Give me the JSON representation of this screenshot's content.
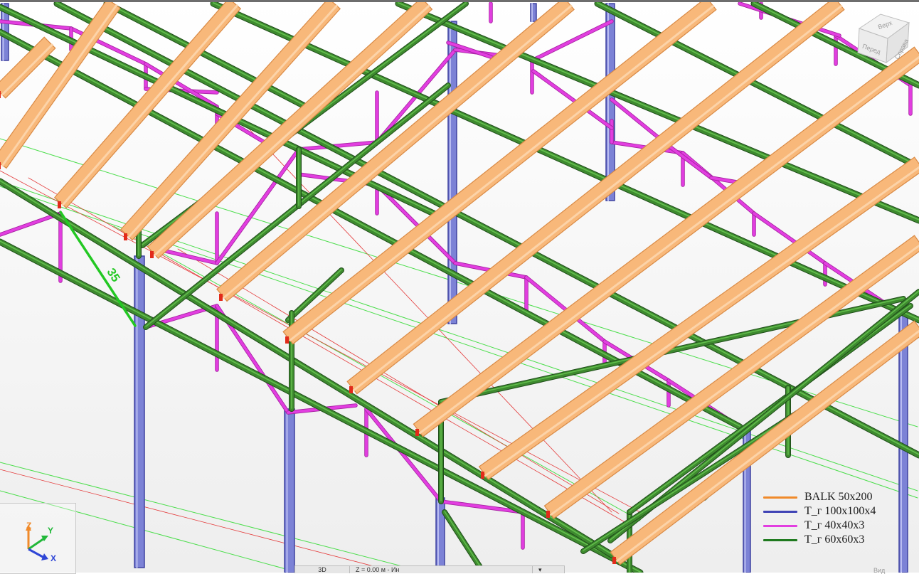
{
  "viewport": {
    "background_top": "#ffffff",
    "background_bottom": "#eeeeee"
  },
  "members": {
    "truss_color": "#3e8a2f",
    "truss_highlight": "#63bf4d",
    "brace_color": "#e23ee0",
    "purlin_color": "#f8b87a",
    "purlin_edge": "#d98a45",
    "column_color": "#7c82d6",
    "column_edge": "#3f43a0",
    "guide_green": "#4cde4c",
    "guide_red": "#e43a3a",
    "node_marker": "#e22a1a"
  },
  "dimension": {
    "value": "35"
  },
  "legend": {
    "items": [
      {
        "label": "BALK 50x200",
        "color": "#f08a2a"
      },
      {
        "label": "T_г 100x100x4",
        "color": "#3f43b5"
      },
      {
        "label": "T_г 40x40x3",
        "color": "#e23ee0"
      },
      {
        "label": "T_г 60x60x3",
        "color": "#1f7a1f"
      }
    ]
  },
  "view_cube": {
    "top_label": "Верх",
    "front_label": "Перед",
    "right_label": "Справа"
  },
  "axis_triad": {
    "x_label": "X",
    "y_label": "Y",
    "z_label": "Z",
    "x_color": "#2f46d6",
    "y_color": "#22b83a",
    "z_color": "#f08a2a"
  },
  "toolbar": {
    "view_mode": "3D",
    "z_level": "Z = 0.00 м - Ин",
    "right_label": "Вид"
  }
}
